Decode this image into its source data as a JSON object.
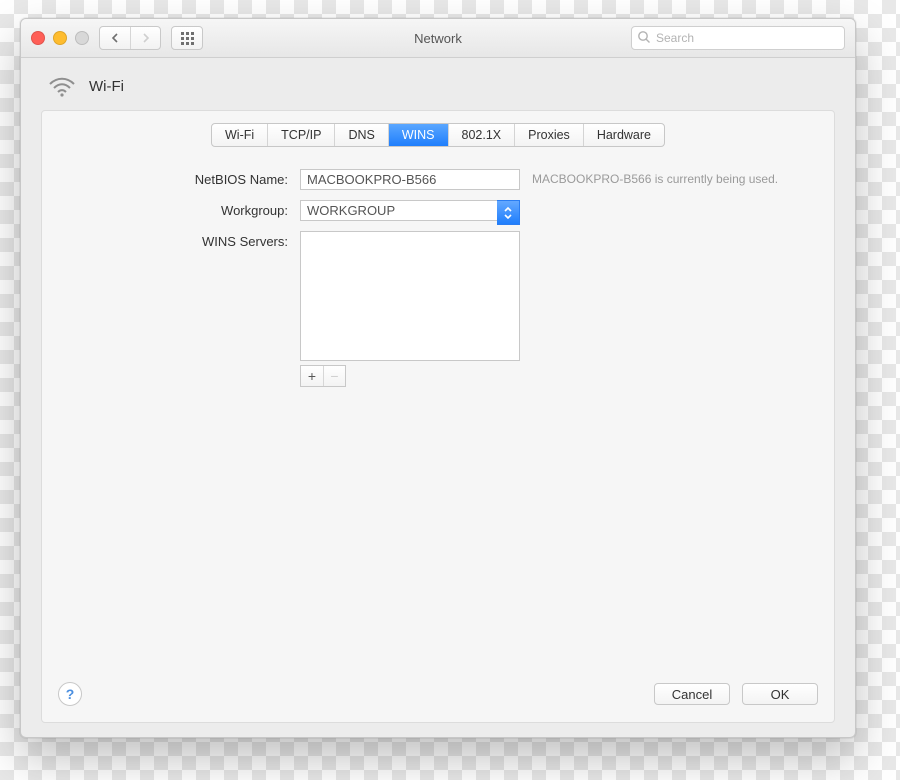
{
  "window": {
    "title": "Network"
  },
  "toolbar": {
    "search_placeholder": "Search"
  },
  "header": {
    "title": "Wi-Fi"
  },
  "tabs": [
    {
      "label": "Wi-Fi"
    },
    {
      "label": "TCP/IP"
    },
    {
      "label": "DNS"
    },
    {
      "label": "WINS",
      "active": true
    },
    {
      "label": "802.1X"
    },
    {
      "label": "Proxies"
    },
    {
      "label": "Hardware"
    }
  ],
  "form": {
    "netbios_label": "NetBIOS Name:",
    "netbios_value": "MACBOOKPRO-B566",
    "netbios_hint": "MACBOOKPRO-B566 is currently being used.",
    "workgroup_label": "Workgroup:",
    "workgroup_value": "WORKGROUP",
    "wins_label": "WINS Servers:",
    "add_label": "+",
    "remove_label": "−"
  },
  "footer": {
    "help": "?",
    "cancel": "Cancel",
    "ok": "OK"
  }
}
